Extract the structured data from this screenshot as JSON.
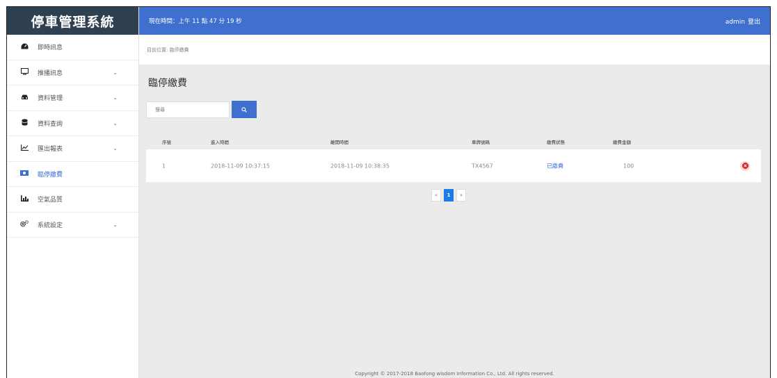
{
  "brand": "停車管理系統",
  "topbar": {
    "time_text": "現在時間：上午 11 點 47 分 19 秒",
    "username": "admin",
    "logout": "登出"
  },
  "breadcrumb": "目前位置: 臨停繳費",
  "sidebar": {
    "items": [
      {
        "label": "即時訊息",
        "icon": "dashboard-icon"
      },
      {
        "label": "推播訊息",
        "icon": "monitor-icon"
      },
      {
        "label": "資料管理",
        "icon": "car-icon"
      },
      {
        "label": "資料查詢",
        "icon": "database-icon"
      },
      {
        "label": "匯出報表",
        "icon": "line-chart-icon"
      },
      {
        "label": "臨停繳費",
        "icon": "money-icon"
      },
      {
        "label": "空氣品質",
        "icon": "bar-chart-icon"
      },
      {
        "label": "系統設定",
        "icon": "gears-icon"
      }
    ]
  },
  "page": {
    "title": "臨停繳費",
    "search_placeholder": "搜尋"
  },
  "table": {
    "headers": [
      "序號",
      "進入時間",
      "離開時間",
      "車牌號碼",
      "繳費狀態",
      "繳費金額"
    ],
    "rows": [
      {
        "no": "1",
        "in": "2018-11-09 10:37:15",
        "out": "2018-11-09 10:38:35",
        "plate": "TX4567",
        "status": "已繳費",
        "amount": "100"
      }
    ]
  },
  "pagination": {
    "prev": "«",
    "current": "1",
    "next": "»"
  },
  "footer": "Copyright © 2017-2018 Baofong wisdom Information Co., Ltd. All rights reserved.",
  "colors": {
    "accent": "#3f6fcf",
    "brand_bg": "#2f4050",
    "active_page": "#1c7de5"
  }
}
